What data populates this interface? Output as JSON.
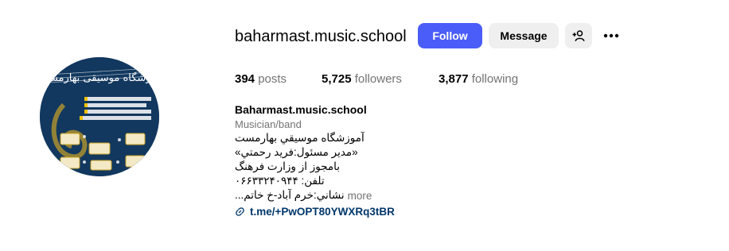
{
  "profile": {
    "username": "baharmast.music.school",
    "full_name": "Baharmast.music.school",
    "category": "Musician/band"
  },
  "actions": {
    "follow_label": "Follow",
    "message_label": "Message"
  },
  "stats": {
    "posts_count": "394",
    "posts_label": "posts",
    "followers_count": "5,725",
    "followers_label": "followers",
    "following_count": "3,877",
    "following_label": "following"
  },
  "bio": {
    "lines": [
      "آموزشگاه موسيقي بهارمست",
      "«مدير مسئول:فريد رحمتي»",
      "بامجوز از وزارت فرهنگ",
      "تلفن: ۰۶۶۳۳۲۴۰۹۴۴",
      "نشاني:خرم آباد-خ خاتم..."
    ],
    "more_label": "more",
    "link_text": "t.me/+PwOPT80YWXRq3tBR"
  },
  "avatar": {
    "title_text": "آموزشگاه موسیقی بهارمست"
  },
  "colors": {
    "follow_bg": "#4a5df9",
    "secondary_bg": "#efefef",
    "muted_text": "#737373",
    "link_text": "#00376b",
    "avatar_bg": "#12385f"
  },
  "icons": {
    "suggest": "person-plus-icon",
    "more": "more-options-icon",
    "link": "link-icon"
  }
}
